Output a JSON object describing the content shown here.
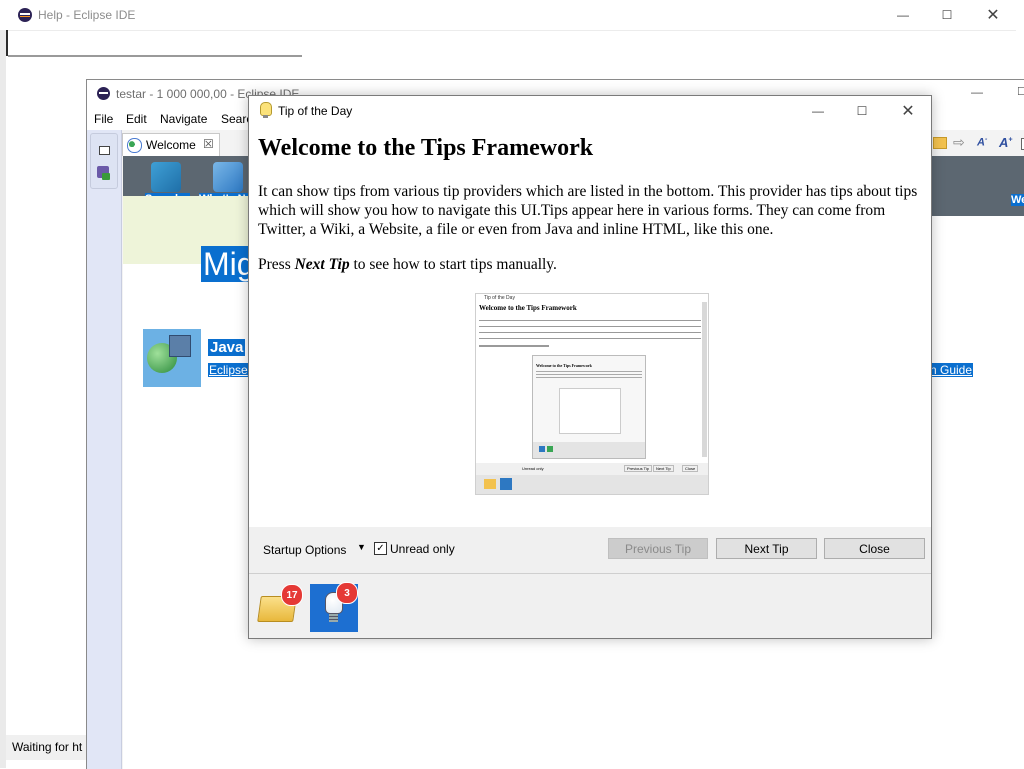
{
  "help_window": {
    "title": "Help - Eclipse IDE",
    "status": "Waiting for ht"
  },
  "eclipse_window": {
    "title": "testar - 1 000 000,00 - Eclipse IDE",
    "menu": [
      "File",
      "Edit",
      "Navigate",
      "Searc"
    ],
    "welcome_tab": "Welcome",
    "welcome": {
      "samples": "Samples",
      "whats_new": "What's Ne",
      "migrate": "Mig",
      "java_title": "Java",
      "java_link": "Eclipse",
      "guide_link": "n Guide",
      "right_edge": "We"
    }
  },
  "dialog": {
    "title": "Tip of the Day",
    "heading": "Welcome to the Tips Framework",
    "paragraph": "It can show tips from various tip providers which are listed in the bottom. This provider has tips about tips which will show you how to navigate this UI.Tips appear here in various forms. They can come from Twitter, a Wiki, a Website, a file or even from Java and inline HTML, like this one.",
    "press_prefix": "Press ",
    "press_bold": "Next Tip",
    "press_suffix": " to see how to start tips manually.",
    "startup_options": "Startup Options",
    "unread_only": "Unread only",
    "unread_checked": true,
    "previous_tip": "Previous Tip",
    "next_tip": "Next Tip",
    "close": "Close",
    "providers": [
      {
        "icon": "folder-icon",
        "count": "17"
      },
      {
        "icon": "lightbulb-icon",
        "count": "3"
      }
    ],
    "thumbnail": {
      "title": "Tip of the Day",
      "heading": "Welcome to the Tips Framework",
      "inner_title": "Welcome to the Tips Framework",
      "unread_only": "Unread only",
      "prev": "Previous Tip",
      "next": "Next Tip",
      "close": "Close"
    }
  }
}
